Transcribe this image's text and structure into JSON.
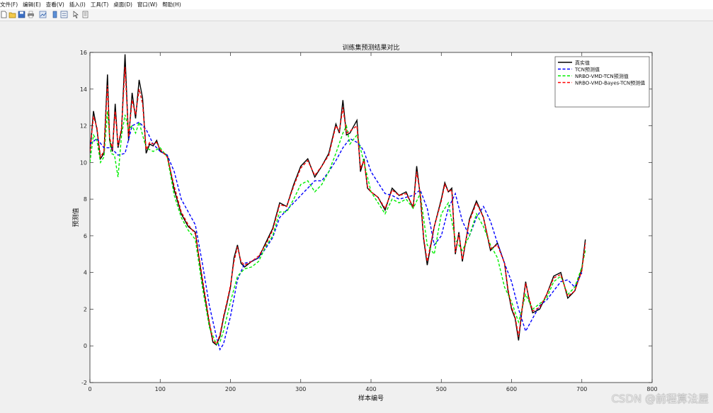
{
  "menu": {
    "items": [
      "文件(F)",
      "编辑(E)",
      "查看(V)",
      "插入(I)",
      "工具(T)",
      "桌面(D)",
      "窗口(W)",
      "帮助(H)"
    ]
  },
  "toolbar": {
    "icons": [
      "new-file-icon",
      "open-folder-icon",
      "save-icon",
      "print-icon",
      "link-plot-icon",
      "insert-colorbar-icon",
      "insert-legend-icon",
      "edit-plot-arrow-icon",
      "property-inspector-icon"
    ]
  },
  "colors": {
    "true": "#000000",
    "tcn": "#0000ff",
    "vmd": "#00ee00",
    "bayes": "#ff0000"
  },
  "chart_data": {
    "type": "line",
    "title": "训练集预测结果对比",
    "xlabel": "样本编号",
    "ylabel": "预测值",
    "xlim": [
      0,
      800
    ],
    "ylim": [
      -2,
      16
    ],
    "xticks": [
      "0",
      "100",
      "200",
      "300",
      "400",
      "500",
      "600",
      "700",
      "800"
    ],
    "yticks": [
      "-2",
      "0",
      "2",
      "4",
      "6",
      "8",
      "10",
      "12",
      "14",
      "16"
    ],
    "legend_position": "top-right",
    "series": [
      {
        "name": "真实值",
        "style": "solid",
        "color": "#000000",
        "x": [
          0,
          5,
          10,
          15,
          20,
          25,
          28,
          32,
          36,
          40,
          45,
          50,
          55,
          60,
          65,
          70,
          75,
          80,
          85,
          90,
          95,
          100,
          110,
          120,
          130,
          140,
          150,
          160,
          170,
          175,
          180,
          185,
          190,
          195,
          200,
          205,
          210,
          215,
          220,
          230,
          240,
          250,
          260,
          270,
          280,
          290,
          300,
          310,
          320,
          330,
          340,
          350,
          355,
          360,
          365,
          370,
          380,
          385,
          390,
          395,
          400,
          410,
          420,
          430,
          440,
          450,
          460,
          465,
          470,
          475,
          480,
          490,
          500,
          505,
          510,
          515,
          520,
          525,
          530,
          540,
          550,
          560,
          570,
          580,
          590,
          595,
          600,
          605,
          610,
          615,
          620,
          625,
          630,
          640,
          650,
          660,
          670,
          680,
          690,
          700,
          705
        ],
        "y": [
          10.5,
          12.8,
          11.8,
          10.2,
          10.5,
          14.8,
          11.2,
          10.6,
          13.2,
          10.8,
          11.8,
          15.9,
          11.2,
          13.8,
          12.4,
          14.5,
          13.5,
          10.5,
          11.0,
          10.9,
          11.2,
          10.6,
          10.4,
          8.5,
          7.2,
          6.5,
          6.2,
          3.5,
          1.2,
          0.2,
          0.05,
          0.5,
          1.5,
          2.3,
          3.2,
          4.8,
          5.5,
          4.5,
          4.3,
          4.6,
          4.8,
          5.6,
          6.4,
          7.8,
          7.6,
          8.8,
          9.8,
          10.2,
          9.2,
          9.8,
          10.5,
          12.1,
          11.6,
          13.4,
          11.5,
          11.6,
          12.3,
          9.5,
          10.2,
          8.6,
          8.4,
          8.1,
          7.4,
          8.6,
          8.2,
          8.4,
          7.5,
          9.8,
          8.2,
          5.8,
          4.4,
          6.5,
          8.0,
          8.9,
          8.4,
          8.6,
          5.0,
          6.2,
          4.6,
          6.9,
          7.9,
          7.0,
          5.2,
          5.6,
          4.5,
          3.0,
          2.0,
          1.5,
          0.3,
          2.0,
          3.5,
          2.5,
          1.8,
          2.0,
          2.8,
          3.8,
          4.0,
          2.6,
          3.0,
          4.2,
          5.8
        ]
      },
      {
        "name": "TCN预测值",
        "style": "dashed",
        "color": "#0000ff",
        "x": [
          0,
          10,
          20,
          30,
          40,
          50,
          60,
          70,
          80,
          90,
          100,
          110,
          120,
          130,
          140,
          150,
          160,
          170,
          180,
          185,
          190,
          200,
          210,
          220,
          230,
          240,
          250,
          260,
          270,
          280,
          290,
          300,
          310,
          320,
          330,
          340,
          350,
          360,
          370,
          380,
          385,
          390,
          400,
          410,
          420,
          430,
          440,
          450,
          460,
          470,
          480,
          490,
          500,
          510,
          520,
          530,
          540,
          550,
          560,
          570,
          580,
          590,
          600,
          610,
          620,
          630,
          640,
          650,
          660,
          670,
          680,
          690,
          700
        ],
        "y": [
          11.0,
          11.3,
          10.8,
          10.8,
          10.4,
          10.5,
          12.0,
          12.2,
          11.8,
          11.0,
          10.6,
          10.4,
          9.5,
          8.0,
          7.3,
          6.6,
          4.5,
          2.2,
          0.5,
          -0.2,
          0.1,
          1.6,
          3.6,
          4.5,
          4.6,
          4.8,
          5.3,
          5.9,
          7.0,
          7.4,
          7.8,
          8.2,
          8.6,
          9.0,
          9.0,
          9.5,
          10.1,
          10.8,
          11.3,
          11.1,
          10.9,
          10.6,
          9.5,
          8.9,
          8.3,
          8.2,
          8.0,
          8.1,
          8.2,
          8.5,
          7.5,
          5.5,
          6.0,
          7.5,
          8.3,
          6.8,
          6.0,
          7.0,
          7.6,
          6.8,
          5.6,
          4.5,
          3.5,
          2.0,
          0.8,
          1.5,
          2.2,
          2.5,
          3.0,
          3.5,
          3.6,
          3.2,
          4.0
        ]
      },
      {
        "name": "NRBO-VMD-TCN预测值",
        "style": "dashed",
        "color": "#00ee00",
        "x": [
          0,
          5,
          10,
          15,
          20,
          25,
          30,
          35,
          40,
          45,
          50,
          55,
          60,
          65,
          70,
          75,
          80,
          90,
          100,
          110,
          120,
          130,
          140,
          150,
          160,
          170,
          180,
          185,
          190,
          200,
          210,
          220,
          230,
          240,
          250,
          260,
          270,
          280,
          290,
          300,
          310,
          320,
          330,
          340,
          350,
          360,
          365,
          370,
          380,
          390,
          400,
          410,
          420,
          430,
          440,
          450,
          460,
          470,
          480,
          490,
          500,
          510,
          520,
          530,
          540,
          550,
          560,
          570,
          580,
          590,
          600,
          610,
          620,
          630,
          640,
          650,
          660,
          670,
          680,
          690,
          700,
          705
        ],
        "y": [
          10.0,
          11.5,
          11.2,
          10.0,
          10.3,
          12.8,
          10.5,
          10.4,
          9.2,
          11.5,
          12.6,
          11.8,
          12.0,
          11.6,
          12.2,
          11.5,
          10.8,
          10.6,
          10.8,
          10.3,
          8.2,
          7.0,
          6.3,
          5.8,
          3.2,
          1.0,
          0.1,
          0.2,
          0.8,
          2.4,
          3.8,
          4.2,
          4.3,
          4.6,
          5.4,
          6.0,
          7.3,
          7.3,
          8.0,
          8.8,
          9.0,
          8.4,
          8.8,
          9.5,
          10.5,
          11.6,
          12.0,
          11.0,
          11.5,
          10.0,
          8.4,
          7.8,
          7.2,
          8.0,
          7.8,
          8.0,
          7.5,
          8.3,
          5.5,
          5.0,
          7.2,
          7.8,
          5.8,
          5.2,
          6.0,
          7.2,
          6.5,
          5.5,
          4.8,
          3.2,
          2.4,
          1.3,
          2.8,
          2.0,
          2.3,
          2.6,
          3.5,
          3.8,
          2.8,
          3.2,
          4.3,
          5.2
        ]
      },
      {
        "name": "NRBO-VMD-Bayes-TCN预测值",
        "style": "dashed",
        "color": "#ff0000",
        "x": [
          0,
          5,
          10,
          15,
          20,
          25,
          28,
          32,
          36,
          40,
          45,
          50,
          55,
          60,
          65,
          70,
          75,
          80,
          85,
          90,
          95,
          100,
          110,
          120,
          130,
          140,
          150,
          160,
          170,
          175,
          180,
          185,
          190,
          195,
          200,
          205,
          210,
          215,
          220,
          230,
          240,
          250,
          260,
          270,
          280,
          290,
          300,
          310,
          320,
          330,
          340,
          350,
          355,
          360,
          365,
          370,
          380,
          385,
          390,
          395,
          400,
          410,
          420,
          430,
          440,
          450,
          460,
          465,
          470,
          475,
          480,
          490,
          500,
          505,
          510,
          515,
          520,
          525,
          530,
          540,
          550,
          560,
          570,
          580,
          590,
          595,
          600,
          605,
          610,
          615,
          620,
          625,
          630,
          640,
          650,
          660,
          670,
          680,
          690,
          700,
          705
        ],
        "y": [
          10.6,
          12.5,
          11.9,
          10.3,
          10.6,
          14.2,
          11.4,
          10.7,
          12.8,
          10.9,
          11.9,
          15.2,
          11.4,
          13.4,
          12.6,
          14.0,
          13.2,
          10.7,
          11.1,
          11.0,
          11.1,
          10.7,
          10.3,
          8.7,
          7.3,
          6.6,
          6.1,
          3.7,
          1.3,
          0.3,
          0.1,
          0.6,
          1.6,
          2.4,
          3.3,
          4.6,
          5.4,
          4.6,
          4.4,
          4.6,
          4.9,
          5.5,
          6.3,
          7.7,
          7.6,
          8.7,
          9.7,
          10.1,
          9.3,
          9.8,
          10.4,
          12.0,
          11.7,
          13.0,
          11.6,
          11.7,
          12.0,
          9.7,
          10.1,
          8.7,
          8.4,
          8.1,
          7.5,
          8.5,
          8.2,
          8.3,
          7.6,
          9.5,
          8.3,
          5.9,
          4.6,
          6.5,
          7.9,
          8.8,
          8.4,
          8.5,
          5.1,
          6.1,
          4.7,
          6.8,
          7.8,
          7.0,
          5.3,
          5.5,
          4.5,
          3.1,
          2.1,
          1.6,
          0.5,
          2.0,
          3.4,
          2.6,
          1.9,
          2.1,
          2.8,
          3.7,
          3.9,
          2.7,
          3.0,
          4.1,
          5.6
        ]
      }
    ]
  },
  "watermark": "CSDN @前程算法屋"
}
